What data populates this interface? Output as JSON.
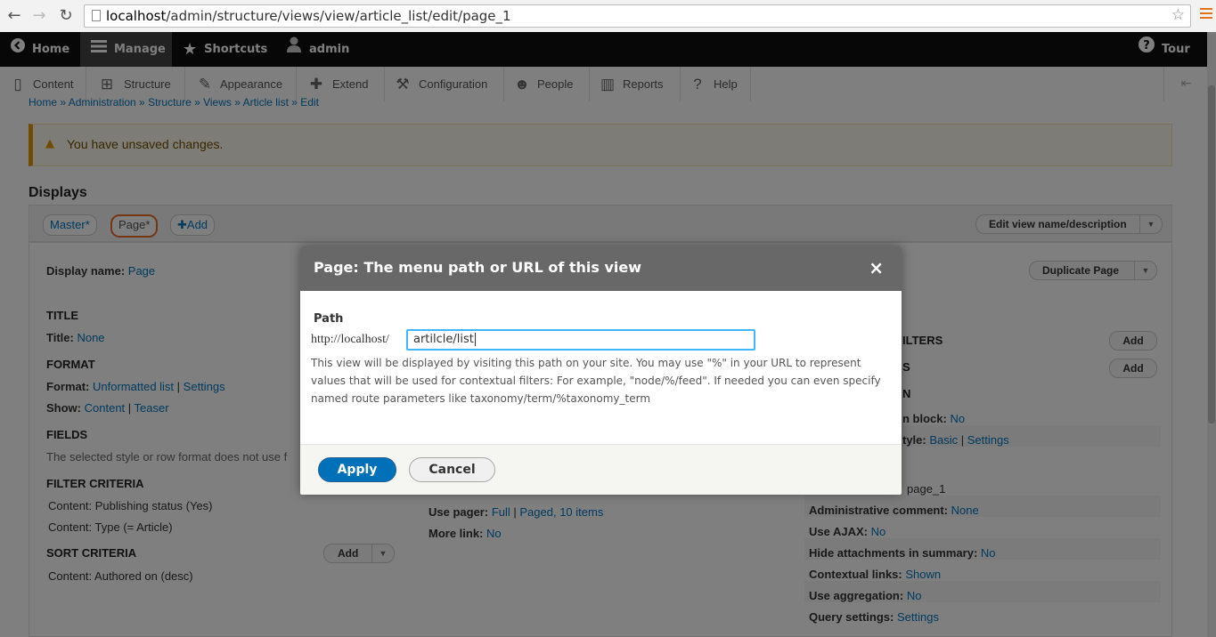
{
  "browser": {
    "url_host": "localhost",
    "url_path": "/admin/structure/views/view/article_list/edit/page_1"
  },
  "toolbar": {
    "home": "Home",
    "manage": "Manage",
    "shortcuts": "Shortcuts",
    "user": "admin",
    "tour": "Tour"
  },
  "tray": {
    "items": [
      "Content",
      "Structure",
      "Appearance",
      "Extend",
      "Configuration",
      "People",
      "Reports",
      "Help"
    ]
  },
  "page": {
    "breadcrumb": "Home » Administration » Structure » Views » Article list » Edit",
    "warning": "You have unsaved changes.",
    "displays_title": "Displays",
    "tabs": {
      "master": "Master*",
      "page": "Page*",
      "add": "Add"
    },
    "edit_view_name": "Edit view name/description",
    "display_name_label": "Display name:",
    "display_name_value": "Page",
    "duplicate_page": "Duplicate Page",
    "left": {
      "title_heading": "TITLE",
      "title_label": "Title:",
      "title_value": "None",
      "format_heading": "FORMAT",
      "format_label": "Format:",
      "format_value": "Unformatted list",
      "format_settings": "Settings",
      "show_label": "Show:",
      "show_value": "Content",
      "show_teaser": "Teaser",
      "fields_heading": "FIELDS",
      "fields_text": "The selected style or row format does not use f",
      "filter_heading": "FILTER CRITERIA",
      "filter_1": "Content: Publishing status (Yes)",
      "filter_2": "Content: Type (= Article)",
      "sort_heading": "SORT CRITERIA",
      "sort_add": "Add",
      "sort_1": "Content: Authored on (desc)"
    },
    "middle": {
      "use_pager_label": "Use pager:",
      "use_pager_full": "Full",
      "use_pager_paged": "Paged, 10 items",
      "more_link_label": "More link:",
      "more_link_value": "No"
    },
    "right": {
      "filters_suffix": "ILTERS",
      "add_1": "Add",
      "s_suffix": "S",
      "add_2": "Add",
      "n_suffix": "N",
      "block_label": "n block:",
      "block_value": "No",
      "style_label": "tyle:",
      "style_value": "Basic",
      "style_settings": "Settings",
      "machine_name": "page_1",
      "admin_comment_label": "Administrative comment:",
      "admin_comment_value": "None",
      "use_ajax_label": "Use AJAX:",
      "use_ajax_value": "No",
      "hide_attach_label": "Hide attachments in summary:",
      "hide_attach_value": "No",
      "contextual_label": "Contextual links:",
      "contextual_value": "Shown",
      "aggregation_label": "Use aggregation:",
      "aggregation_value": "No",
      "query_label": "Query settings:",
      "query_value": "Settings"
    }
  },
  "dialog": {
    "title": "Page: The menu path or URL of this view",
    "close": "×",
    "field_label": "Path",
    "prefix": "http://localhost/",
    "path_value": "artilcle/list",
    "description": "This view will be displayed by visiting this path on your site. You may use \"%\" in your URL to represent values that will be used for contextual filters: For example, \"node/%/feed\". If needed you can even specify named route parameters like taxonomy/term/%taxonomy_term",
    "apply": "Apply",
    "cancel": "Cancel"
  }
}
